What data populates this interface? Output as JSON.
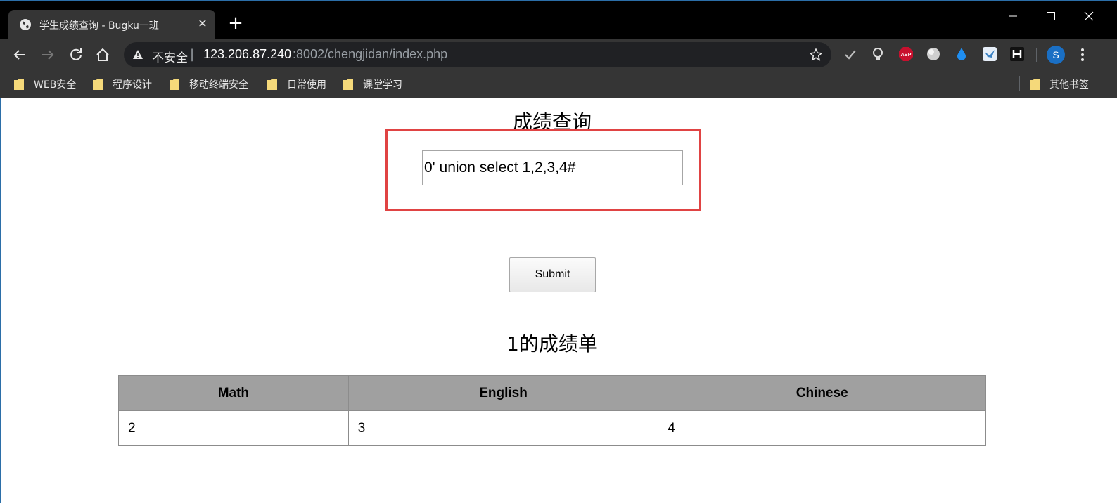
{
  "browser": {
    "tab_title": "学生成绩查询 - Bugku一班",
    "insecure_label": "不安全",
    "separator": "|",
    "url_host": "123.206.87.240",
    "url_path": ":8002/chengjidan/index.php",
    "avatar_letter": "S",
    "new_tab_glyph": "+",
    "close_tab_glyph": "✕",
    "extensions": [
      "check-icon",
      "lightbulb-icon",
      "adblock-icon",
      "globe-extension-icon",
      "water-drop-icon",
      "bird-extension-icon",
      "h-extension-icon"
    ]
  },
  "bookmarks": {
    "items": [
      {
        "label": "WEB安全"
      },
      {
        "label": "程序设计"
      },
      {
        "label": "移动终端安全"
      },
      {
        "label": "日常使用"
      },
      {
        "label": "课堂学习"
      }
    ],
    "other": "其他书签"
  },
  "page": {
    "title": "成绩查询",
    "query_value": "0' union select 1,2,3,4#",
    "submit_label": "Submit",
    "result_title": "1的成绩单",
    "highlight_color": "#e04343",
    "table": {
      "headers": [
        "Math",
        "English",
        "Chinese"
      ],
      "rows": [
        [
          "2",
          "3",
          "4"
        ]
      ]
    }
  }
}
